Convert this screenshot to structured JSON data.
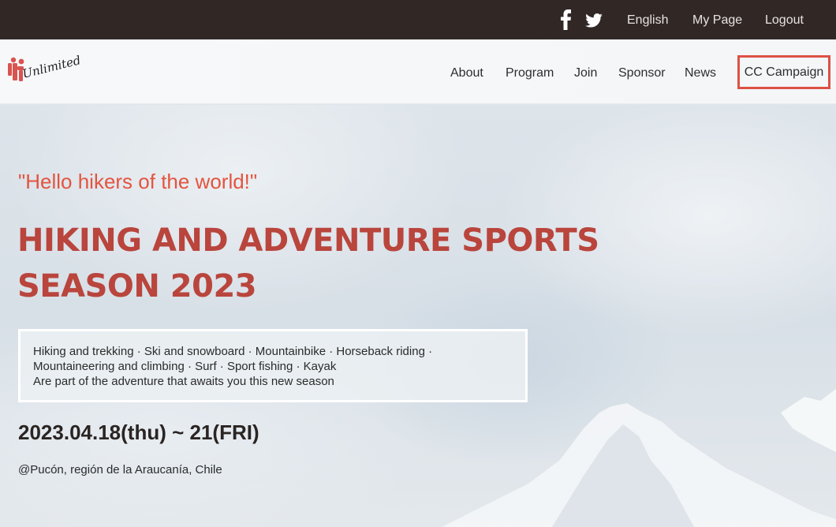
{
  "topbar": {
    "social_icons": [
      "facebook-icon",
      "twitter-icon"
    ],
    "links": {
      "english": "English",
      "mypage": "My Page",
      "logout": "Logout"
    }
  },
  "navbar": {
    "logo_text": "Unlimited",
    "items": {
      "about": "About",
      "program": "Program",
      "join": "Join",
      "sponsor": "Sponsor",
      "news": "News",
      "cc": "CC Campaign"
    }
  },
  "hero": {
    "tagline": "\"Hello hikers of the world!\"",
    "headline_line1": "HIKING AND ADVENTURE SPORTS",
    "headline_line2": "SEASON 2023",
    "activities_line1": "Hiking and trekking · Ski and snowboard · Mountainbike · Horseback riding ·",
    "activities_line2": "Mountaineering and climbing · Surf · Sport fishing · Kayak",
    "activities_line3": "Are part of the adventure that awaits you this new season",
    "dates": "2023.04.18(thu) ~ 21(FRI)",
    "location": "@Pucón, región de la Araucanía, Chile"
  },
  "colors": {
    "topbar_bg": "#312826",
    "accent": "#e4543f",
    "headline": "#b9453d",
    "highlight_border": "#dd5145"
  }
}
